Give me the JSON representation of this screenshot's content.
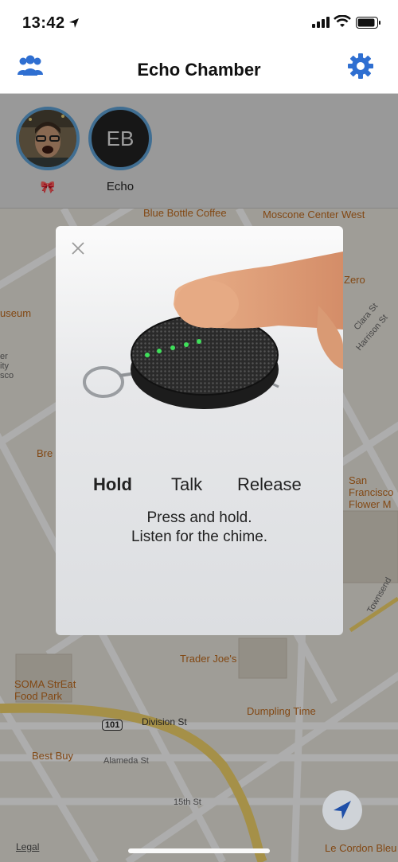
{
  "status_bar": {
    "time": "13:42"
  },
  "nav": {
    "title": "Echo Chamber",
    "left_icon": "group-icon",
    "right_icon": "gear-icon",
    "accent_color": "#2f6fd1"
  },
  "avatars": [
    {
      "label": "🎀",
      "kind": "photo"
    },
    {
      "label": "Echo",
      "initials": "EB",
      "kind": "initials"
    }
  ],
  "map": {
    "labels": [
      {
        "text": "Blue Bottle Coffee",
        "kind": "poi"
      },
      {
        "text": "Moscone Center West",
        "kind": "poi"
      },
      {
        "text": "useum",
        "kind": "poi"
      },
      {
        "text": "Zero",
        "kind": "poi"
      },
      {
        "text": "Clara St",
        "kind": "street"
      },
      {
        "text": "Harrison St",
        "kind": "street"
      },
      {
        "text": "er ity sco",
        "kind": "street"
      },
      {
        "text": "Bre",
        "kind": "poi"
      },
      {
        "text": "San Francisco Flower M",
        "kind": "poi"
      },
      {
        "text": "Townsend",
        "kind": "street"
      },
      {
        "text": "Trader Joe's",
        "kind": "poi"
      },
      {
        "text": "SOMA StrEat Food Park",
        "kind": "poi"
      },
      {
        "text": "Dumpling Time",
        "kind": "poi"
      },
      {
        "text": "Division St",
        "kind": "street"
      },
      {
        "text": "101",
        "kind": "shield"
      },
      {
        "text": "Best Buy",
        "kind": "poi"
      },
      {
        "text": "Alameda St",
        "kind": "street"
      },
      {
        "text": "15th St",
        "kind": "street"
      },
      {
        "text": "Le Cordon Bleu College of",
        "kind": "poi"
      },
      {
        "text": "Legal",
        "kind": "link"
      }
    ]
  },
  "modal": {
    "close_icon": "close-icon",
    "steps": [
      "Hold",
      "Talk",
      "Release"
    ],
    "instruction_line1": "Press and hold.",
    "instruction_line2": "Listen for the chime.",
    "led_color": "#3fe05a"
  }
}
